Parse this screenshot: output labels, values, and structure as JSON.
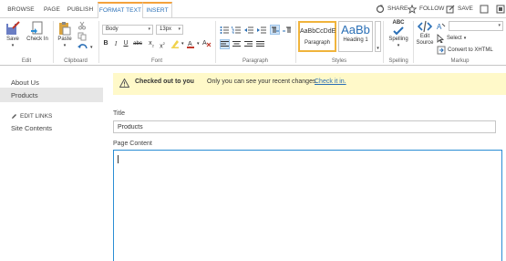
{
  "tabs": [
    {
      "label": "BROWSE"
    },
    {
      "label": "PAGE"
    },
    {
      "label": "PUBLISH"
    },
    {
      "label": "FORMAT TEXT"
    },
    {
      "label": "INSERT"
    }
  ],
  "top_actions": {
    "share": "SHARE",
    "follow": "FOLLOW",
    "save": "SAVE"
  },
  "ribbon": {
    "edit": {
      "save": "Save",
      "check_in": "Check In",
      "group": "Edit"
    },
    "clipboard": {
      "paste": "Paste",
      "group": "Clipboard"
    },
    "font": {
      "font_name": "Body",
      "font_size": "13px",
      "group": "Font",
      "bold": "B",
      "italic": "I",
      "underline": "U",
      "strike": "abc",
      "sub": "x",
      "sup": "x"
    },
    "paragraph": {
      "group": "Paragraph"
    },
    "styles": {
      "paragraph_sample": "AaBbCcDdE",
      "paragraph": "Paragraph",
      "heading_sample": "AaBb",
      "heading": "Heading 1",
      "group": "Styles"
    },
    "spelling": {
      "icon_text": "ABC",
      "label": "Spelling",
      "group": "Spelling"
    },
    "markup": {
      "edit_source_1": "Edit",
      "edit_source_2": "Source",
      "select": "Select",
      "convert": "Convert to XHTML",
      "group": "Markup"
    }
  },
  "nav": {
    "items": [
      "About Us",
      "Products"
    ],
    "edit_links": "EDIT LINKS",
    "site_contents": "Site Contents"
  },
  "status": {
    "title": "Checked out to you",
    "message": "Only you can see your recent changes.",
    "link": "Check it in.",
    "color": "#fff9c9"
  },
  "form": {
    "title_label": "Title",
    "title_value": "Products",
    "content_label": "Page Content"
  },
  "colors": {
    "accent": "#f4a23c",
    "link": "#2a6fb6",
    "focus_border": "#2a8dd4"
  }
}
